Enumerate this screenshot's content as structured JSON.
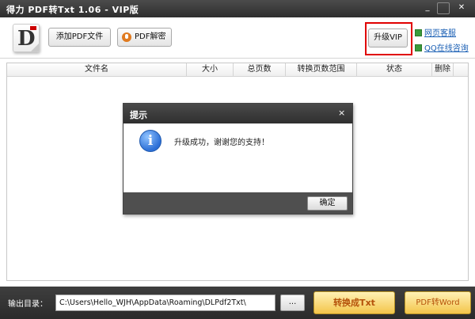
{
  "window": {
    "title": "得力 PDF转Txt 1.06 - VIP版",
    "controls": {
      "minimize": "_",
      "maximize": "",
      "close": "✕"
    }
  },
  "toolbar": {
    "logo_letter": "D",
    "add_pdf_label": "添加PDF文件",
    "decrypt_label": "PDF解密",
    "upgrade_label": "升级VIP",
    "links": [
      "网页客服",
      "QQ在线咨询"
    ]
  },
  "table": {
    "columns": [
      "文件名",
      "大小",
      "总页数",
      "转换页数范围",
      "状态",
      "删除"
    ],
    "rows": []
  },
  "dialog": {
    "title": "提示",
    "close_glyph": "×",
    "icon": "info-icon",
    "icon_glyph": "i",
    "message": "升级成功，谢谢您的支持！",
    "ok_label": "确定"
  },
  "bottom": {
    "output_label": "输出目录：",
    "output_path": "C:\\Users\\Hello_WJH\\AppData\\Roaming\\DLPdf2Txt\\",
    "browse_label": "...",
    "convert_label": "转换成Txt",
    "to_word_label": "PDF转Word"
  },
  "colors": {
    "titlebar": "#3a3a3a",
    "highlight_box": "#e00000",
    "link": "#1a5fb4",
    "convert_button": "#f3c54a",
    "convert_text": "#b5520a"
  }
}
